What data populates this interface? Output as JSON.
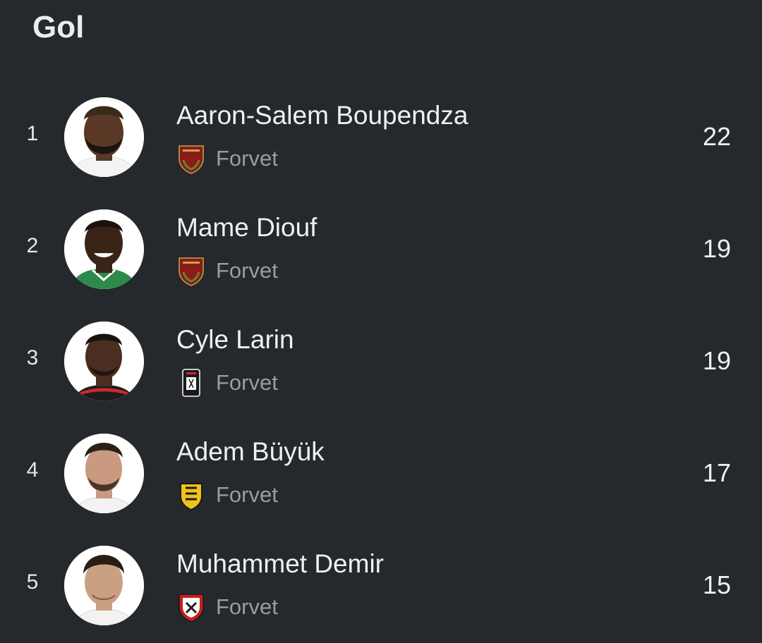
{
  "page": {
    "title": "Gol"
  },
  "players": [
    {
      "rank": "1",
      "name": "Aaron-Salem Boupendza",
      "position": "Forvet",
      "goals": "22",
      "club_crest": "hatayspor-crest",
      "skin": "#5a3826",
      "kit": "#ffffff"
    },
    {
      "rank": "2",
      "name": "Mame Diouf",
      "position": "Forvet",
      "goals": "19",
      "club_crest": "hatayspor-crest",
      "skin": "#3a2418",
      "kit": "#2d8a4a"
    },
    {
      "rank": "3",
      "name": "Cyle Larin",
      "position": "Forvet",
      "goals": "19",
      "club_crest": "besiktas-crest",
      "skin": "#4a2e20",
      "kit": "#cc2a2a"
    },
    {
      "rank": "4",
      "name": "Adem Büyük",
      "position": "Forvet",
      "goals": "17",
      "club_crest": "yeni-malatyaspor-crest",
      "skin": "#c99a80",
      "kit": "#ffffff"
    },
    {
      "rank": "5",
      "name": "Muhammet Demir",
      "position": "Forvet",
      "goals": "15",
      "club_crest": "gaziantep-fk-crest",
      "skin": "#caa083",
      "kit": "#ffffff"
    }
  ]
}
